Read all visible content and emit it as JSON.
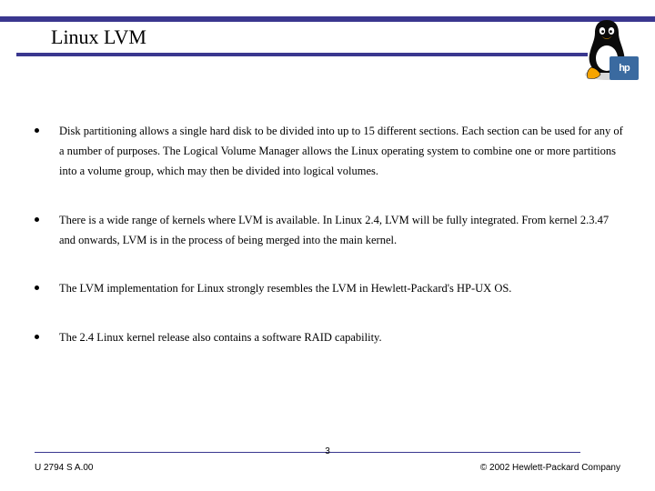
{
  "title": "Linux LVM",
  "bullets": [
    "Disk partitioning allows a single hard disk to be divided into up to 15 different sections.  Each section can be used for any of a number of purposes. The Logical Volume Manager allows the Linux operating system to combine one or more partitions into a volume group, which may then be divided into logical volumes.",
    "There is a wide range of kernels where LVM is available. In Linux 2.4, LVM will be fully integrated. From kernel 2.3.47 and onwards, LVM is in the process of being merged into the main kernel.",
    "The LVM implementation for Linux strongly resembles the LVM in Hewlett-Packard's HP-UX OS.",
    "The 2.4 Linux kernel release also contains a software RAID capability."
  ],
  "footer": {
    "left": "U 2794 S A.00",
    "center": "3",
    "right": "© 2002 Hewlett-Packard Company"
  },
  "hp_label": "hp"
}
